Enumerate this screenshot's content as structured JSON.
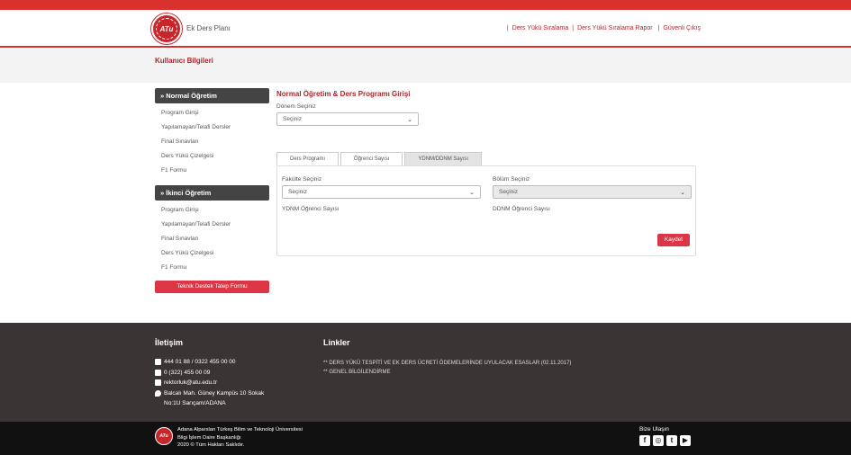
{
  "header": {
    "app_title": "Ek Ders Planı",
    "logo_text": "ATu",
    "nav": [
      "Ders Yükü Sıralama",
      "Ders Yükü Sıralama Rapor",
      "Güvenli Çıkış"
    ]
  },
  "subheader": {
    "title": "Kullanıcı Bilgileri"
  },
  "sidebar": {
    "group1": {
      "title": "» Normal Öğretim",
      "items": [
        "Program Girişi",
        "Yapılamayan/Telafi Dersler",
        "Final Sınavları",
        "Ders Yükü Çizelgesi",
        "F1 Formu"
      ]
    },
    "group2": {
      "title": "» İkinci Öğretim",
      "items": [
        "Program Girişi",
        "Yapılamayan/Telafi Dersler",
        "Final Sınavları",
        "Ders Yükü Çizelgesi",
        "F1 Formu"
      ]
    },
    "support_button": "Teknik Destek Talep Formu"
  },
  "main": {
    "title": "Normal Öğretim & Ders Programı Girişi",
    "term_label": "Dönem Seçiniz",
    "term_value": "Seçiniz",
    "tabs": [
      "Ders Programı",
      "Öğrenci Sayısı",
      "YDNM/DDNM Sayısı"
    ],
    "faculty_label": "Fakülte Seçiniz",
    "faculty_value": "Seçiniz",
    "dept_label": "Bölüm Seçiniz",
    "dept_value": "Seçiniz",
    "ydnm_label": "YDNM Öğrenci Sayısı",
    "ddnm_label": "DDNM Öğrenci Sayısı",
    "save_button": "Kaydet"
  },
  "footer": {
    "contact_title": "İletişim",
    "phone1": "444 01 88  / 0322 455 00 00",
    "fax": "0 (322) 455 00 09",
    "email": "rektorluk@atu.edu.tr",
    "address_line1": "Balcalı Mah. Güney Kampüs 10 Sokak",
    "address_line2": "No:1U Sarıçam/ADANA",
    "links_title": "Linkler",
    "links": [
      "** DERS YÜKÜ TESPİTİ VE EK DERS ÜCRETİ ÖDEMELERİNDE UYULACAK ESASLAR (02.11.2017)",
      "** GENEL BİLGİLENDİRME"
    ]
  },
  "bottom": {
    "logo_text": "ATu",
    "line1": "Adana Alparslan Türkeş Bilim ve Teknoloji Üniversitesi",
    "line2": "Bilgi İşlem Daire Başkanlığı",
    "line3": "2020 © Tüm Hakları Saklıdır.",
    "social_title": "Bize Ulaşın",
    "social_icons": [
      "facebook-icon",
      "instagram-icon",
      "twitter-icon",
      "youtube-icon"
    ]
  }
}
